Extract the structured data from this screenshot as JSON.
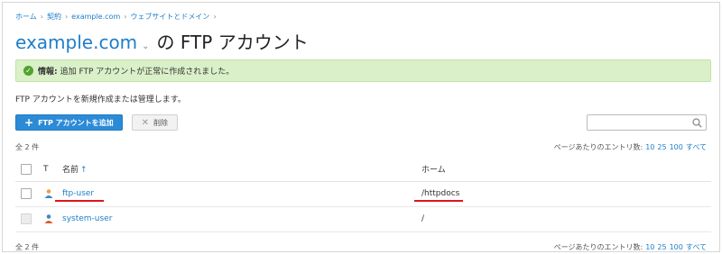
{
  "breadcrumb": [
    "ホーム",
    "契約",
    "example.com",
    "ウェブサイトとドメイン"
  ],
  "title": {
    "domain": "example.com",
    "caret": "⌄",
    "suffix": "の FTP アカウント"
  },
  "alert": {
    "label": "情報:",
    "message": "追加 FTP アカウントが正常に作成されました。"
  },
  "description": "FTP アカウントを新規作成または管理します。",
  "toolbar": {
    "add_label": "FTP アカウントを追加",
    "delete_label": "削除"
  },
  "search": {
    "placeholder": ""
  },
  "summary": {
    "count_label": "全 2 件",
    "per_page_label": "ページあたりのエントリ数:",
    "per_page_options": [
      "10",
      "25",
      "100",
      "すべて"
    ]
  },
  "table": {
    "headers": {
      "type": "T",
      "name": "名前",
      "sort_indicator": "↑",
      "home": "ホーム"
    },
    "rows": [
      {
        "name": "ftp-user",
        "home": "/httpdocs"
      },
      {
        "name": "system-user",
        "home": "/"
      }
    ]
  },
  "colors": {
    "accent": "#1e7ec8",
    "success_bg": "#d9f0c8",
    "annotation": "#e0141e"
  }
}
